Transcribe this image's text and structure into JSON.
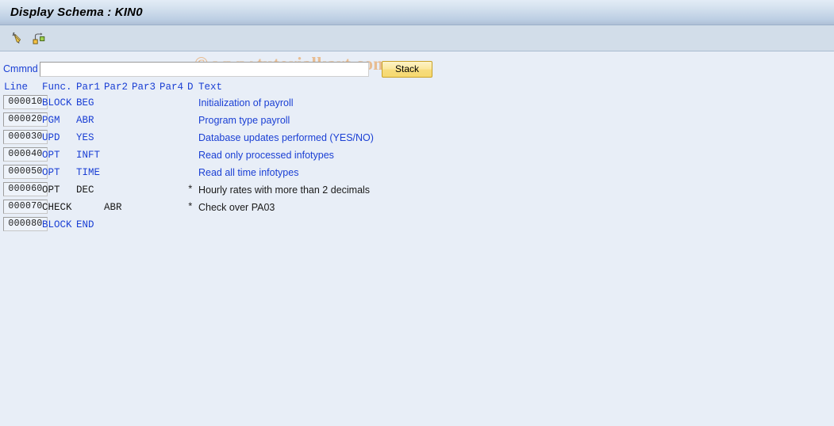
{
  "window": {
    "title": "Display Schema : KIN0"
  },
  "toolbar": {
    "buttons": [
      {
        "name": "edit-pencil-icon",
        "tooltip": "Change"
      },
      {
        "name": "hierarchy-icon",
        "tooltip": "Structure"
      }
    ]
  },
  "watermark": {
    "text": "© www.tutorialkart.com",
    "color": "#e9b98a"
  },
  "command": {
    "label": "Cmmnd",
    "value": "",
    "placeholder": "",
    "stack_label": "Stack"
  },
  "table": {
    "headers": {
      "line": "Line",
      "func": "Func.",
      "par1": "Par1",
      "par2": "Par2",
      "par3": "Par3",
      "par4": "Par4",
      "d": "D",
      "text": "Text"
    },
    "colors": {
      "active": "#1a3fd4",
      "commented": "#1a1a1a"
    },
    "rows": [
      {
        "line": "000010",
        "func": "BLOCK",
        "par1": "BEG",
        "par2": "",
        "par3": "",
        "par4": "",
        "d": "",
        "text": "Initialization of payroll",
        "style": "blue"
      },
      {
        "line": "000020",
        "func": "PGM",
        "par1": "ABR",
        "par2": "",
        "par3": "",
        "par4": "",
        "d": "",
        "text": "Program type payroll",
        "style": "blue"
      },
      {
        "line": "000030",
        "func": "UPD",
        "par1": "YES",
        "par2": "",
        "par3": "",
        "par4": "",
        "d": "",
        "text": "Database updates performed (YES/NO)",
        "style": "blue"
      },
      {
        "line": "000040",
        "func": "OPT",
        "par1": "INFT",
        "par2": "",
        "par3": "",
        "par4": "",
        "d": "",
        "text": "Read only processed infotypes",
        "style": "blue"
      },
      {
        "line": "000050",
        "func": "OPT",
        "par1": "TIME",
        "par2": "",
        "par3": "",
        "par4": "",
        "d": "",
        "text": "Read all time infotypes",
        "style": "blue"
      },
      {
        "line": "000060",
        "func": "OPT",
        "par1": "DEC",
        "par2": "",
        "par3": "",
        "par4": "",
        "d": "*",
        "text": "Hourly rates with more than 2 decimals",
        "style": "dark"
      },
      {
        "line": "000070",
        "func": "CHECK",
        "par1": "",
        "par2": "ABR",
        "par3": "",
        "par4": "",
        "d": "*",
        "text": "Check over PA03",
        "style": "dark"
      },
      {
        "line": "000080",
        "func": "BLOCK",
        "par1": "END",
        "par2": "",
        "par3": "",
        "par4": "",
        "d": "",
        "text": "",
        "style": "blue"
      }
    ]
  }
}
